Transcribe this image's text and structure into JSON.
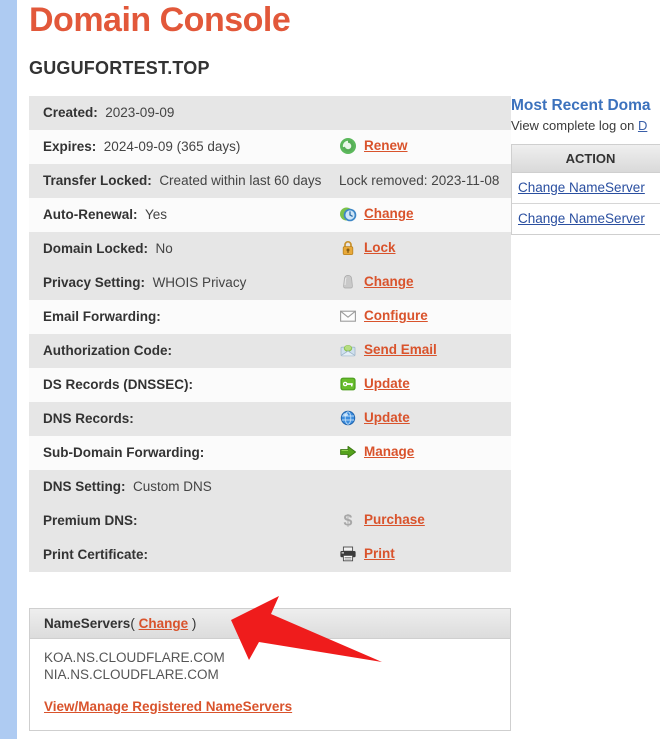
{
  "app": {
    "title": "Domain Console",
    "title_color": "#e2583a",
    "domain": "GUGUFORTEST.TOP"
  },
  "info_rows": [
    {
      "label": "Created:",
      "value": "2023-09-09",
      "action_text": "",
      "action_link": "",
      "icon": "",
      "shade": "shade"
    },
    {
      "label": "Expires:",
      "value": "2024-09-09 (365 days)",
      "action_text": "",
      "action_link": "Renew",
      "icon": "renew-icon",
      "shade": "light"
    },
    {
      "label": "Transfer Locked:",
      "value": "Created within last 60 days",
      "action_text": "Lock removed: 2023-11-08",
      "action_link": "",
      "icon": "",
      "shade": "shade"
    },
    {
      "label": "Auto-Renewal:",
      "value": "Yes",
      "action_text": "",
      "action_link": "Change",
      "icon": "clock-icon",
      "shade": "light"
    },
    {
      "label": "Domain Locked:",
      "value": "No",
      "action_text": "",
      "action_link": "Lock",
      "icon": "lock-icon",
      "shade": "shade"
    },
    {
      "label": "Privacy Setting:",
      "value": "WHOIS Privacy",
      "action_text": "",
      "action_link": "Change",
      "icon": "shield-icon",
      "shade": "shade"
    },
    {
      "label": "Email Forwarding:",
      "value": "",
      "action_text": "",
      "action_link": "Configure",
      "icon": "envelope-icon",
      "shade": "light"
    },
    {
      "label": "Authorization Code:",
      "value": "",
      "action_text": "",
      "action_link": "Send Email",
      "icon": "send-email-icon",
      "shade": "shade"
    },
    {
      "label": "DS Records (DNSSEC):",
      "value": "",
      "action_text": "",
      "action_link": "Update",
      "icon": "key-icon",
      "shade": "light"
    },
    {
      "label": "DNS Records:",
      "value": "",
      "action_text": "",
      "action_link": "Update",
      "icon": "globe-icon",
      "shade": "shade"
    },
    {
      "label": "Sub-Domain Forwarding:",
      "value": "",
      "action_text": "",
      "action_link": "Manage",
      "icon": "arrow-right-icon",
      "shade": "light"
    },
    {
      "label": "DNS Setting:",
      "value": "Custom DNS",
      "action_text": "",
      "action_link": "",
      "icon": "",
      "shade": "shade"
    },
    {
      "label": "Premium DNS:",
      "value": "",
      "action_text": "",
      "action_link": "Purchase",
      "icon": "dollar-icon",
      "shade": "shade"
    },
    {
      "label": "Print Certificate:",
      "value": "",
      "action_text": "",
      "action_link": "Print",
      "icon": "printer-icon",
      "shade": "shade"
    }
  ],
  "nameservers": {
    "heading": "NameServers",
    "change_label": "Change",
    "paren_open": "( ",
    "paren_close": " )",
    "entries": [
      "KOA.NS.CLOUDFLARE.COM",
      "NIA.NS.CLOUDFLARE.COM"
    ],
    "manage_link": "View/Manage Registered NameServers"
  },
  "right_panel": {
    "title": "Most Recent Doma",
    "subtitle_prefix": "View complete log on ",
    "subtitle_link": "D",
    "column_header": "ACTION",
    "rows": [
      "Change NameServer",
      "Change NameServer"
    ]
  },
  "annotation": {
    "arrow_color": "#ef1c1c",
    "arrow_name": "red-arrow-pointing-to-change-link"
  }
}
